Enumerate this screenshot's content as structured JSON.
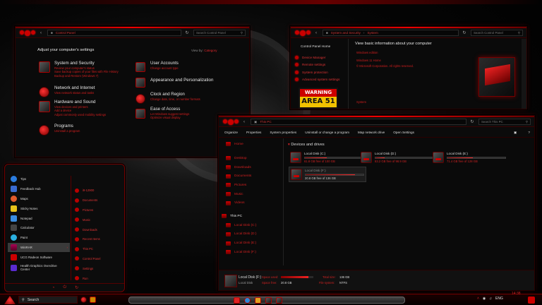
{
  "control_panel": {
    "address": "Control Panel",
    "search_placeholder": "Search Control Panel",
    "heading": "Adjust your computer's settings",
    "view_by": "View by:",
    "view_by_value": "Category",
    "left": [
      {
        "title": "System and Security",
        "links": [
          "Review your computer's status",
          "Save backup copies of your files with File History",
          "Backup and Restore (Windows 7)"
        ]
      },
      {
        "title": "Network and Internet",
        "links": [
          "View network status and tasks"
        ]
      },
      {
        "title": "Hardware and Sound",
        "links": [
          "View devices and printers",
          "Add a device",
          "Adjust commonly used mobility settings"
        ]
      },
      {
        "title": "Programs",
        "links": [
          "Uninstall a program"
        ]
      }
    ],
    "right": [
      {
        "title": "User Accounts",
        "links": [
          "Change account type"
        ]
      },
      {
        "title": "Appearance and Personalization",
        "links": []
      },
      {
        "title": "Clock and Region",
        "links": [
          "Change date, time, or number formats"
        ]
      },
      {
        "title": "Ease of Access",
        "links": [
          "Let Windows suggest settings",
          "Optimize visual display"
        ]
      }
    ]
  },
  "system_window": {
    "address_1": "System and Security",
    "address_2": "System",
    "search_placeholder": "Search Control Panel",
    "nav_home": "Control Panel Home",
    "nav_items": [
      "Device Manager",
      "Remote settings",
      "System protection",
      "Advanced system settings"
    ],
    "heading": "View basic information about your computer",
    "edition_label": "Windows edition",
    "edition": "Windows 11 Home",
    "copyright": "© Microsoft Corporation. All rights reserved.",
    "system_label": "System",
    "warning_top": "WARNING",
    "warning_bottom": "AREA 51"
  },
  "this_pc": {
    "address": "This PC",
    "search_placeholder": "Search This PC",
    "toolbar": [
      "Organize",
      "Properties",
      "System properties",
      "Uninstall or change a program",
      "Map network drive",
      "Open Settings"
    ],
    "sidebar_quick": [
      "Home",
      "Desktop",
      "Downloads",
      "Documents",
      "Pictures",
      "Music",
      "Videos"
    ],
    "sidebar_pc": "This PC",
    "sidebar_drives": [
      "Local Disk (C:)",
      "Local Disk (D:)",
      "Local Disk (E:)",
      "Local Disk (F:)"
    ],
    "section_title": "Devices and drives",
    "drives": [
      {
        "name": "Local Disk (C:)",
        "free": "61.8 GB free of 100 GB",
        "used_fraction": 0.38
      },
      {
        "name": "Local Disk (D:)",
        "free": "83.2 GB free of 98.9 GB",
        "used_fraction": 0.16
      },
      {
        "name": "Local Disk (E:)",
        "free": "71.4 GB free of 128 GB",
        "used_fraction": 0.44
      },
      {
        "name": "Local Disk (F:)",
        "free": "20.8 GB free of 136 GB",
        "used_fraction": 0.85
      }
    ],
    "details": {
      "name": "Local Disk (F:)",
      "type": "Local Disk",
      "space_used_label": "Space used:",
      "space_free_label": "Space free:",
      "space_free": "20.8 GB",
      "total_size_label": "Total size:",
      "total_size": "136 GB",
      "file_system_label": "File system:",
      "file_system": "NTFS"
    }
  },
  "start_menu": {
    "left_items": [
      "Tips",
      "Feedback Hub",
      "Maps",
      "Sticky Notes",
      "Notepad",
      "Calculator",
      "Paint",
      "WinRAR",
      "UCG Radeon Software",
      "Health Graphics Overdrive Center"
    ],
    "right_items": [
      "i9-12900",
      "Documents",
      "Pictures",
      "Music",
      "Downloads",
      "Recent Items",
      "This PC",
      "Control Panel",
      "Settings",
      "Run"
    ]
  },
  "taskbar": {
    "search_label": "Search",
    "time": "14:38",
    "lang": "ENG"
  },
  "colors": {
    "accent": "#e0262b",
    "dark": "#0a0a0a"
  }
}
